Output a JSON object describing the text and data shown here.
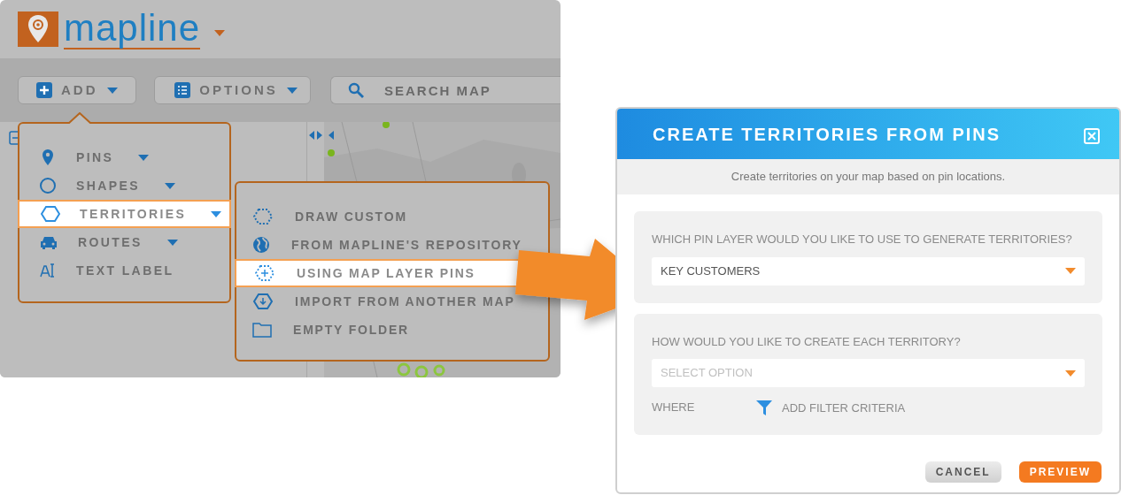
{
  "app": {
    "logo_text": "mapline",
    "toolbar": [
      {
        "kind": "add",
        "label": "ADD"
      },
      {
        "kind": "options",
        "label": "OPTIONS"
      }
    ],
    "search": {
      "placeholder": "SEARCH MAP"
    }
  },
  "add_menu": {
    "items": [
      {
        "kind": "pin",
        "label": "PINS",
        "expandable": true,
        "selected": false
      },
      {
        "kind": "circle",
        "label": "SHAPES",
        "expandable": true,
        "selected": false
      },
      {
        "kind": "hexagon",
        "label": "TERRITORIES",
        "expandable": true,
        "selected": true
      },
      {
        "kind": "car",
        "label": "ROUTES",
        "expandable": true,
        "selected": false
      },
      {
        "kind": "text",
        "label": "TEXT LABEL",
        "expandable": false,
        "selected": false
      }
    ]
  },
  "territories_menu": {
    "items": [
      {
        "kind": "dotted-hexagon",
        "label": "DRAW CUSTOM",
        "selected": false
      },
      {
        "kind": "globe",
        "label": "FROM MAPLINE'S REPOSITORY",
        "selected": false
      },
      {
        "kind": "plus-hexagon",
        "label": "USING MAP LAYER PINS",
        "selected": true
      },
      {
        "kind": "download-hexagon",
        "label": "IMPORT FROM ANOTHER MAP",
        "selected": false
      },
      {
        "kind": "folder",
        "label": "EMPTY FOLDER",
        "selected": false
      }
    ]
  },
  "dialog": {
    "title": "CREATE TERRITORIES FROM PINS",
    "subtitle": "Create territories on your map based on pin locations.",
    "sections": [
      {
        "question": "WHICH PIN LAYER WOULD YOU LIKE TO USE TO GENERATE TERRITORIES?",
        "select": {
          "value": "KEY CUSTOMERS"
        }
      },
      {
        "question": "HOW WOULD YOU LIKE TO CREATE EACH TERRITORY?",
        "select": {
          "placeholder": "SELECT OPTION"
        },
        "where_label": "WHERE",
        "filter_link": "ADD FILTER CRITERIA"
      }
    ],
    "buttons": [
      {
        "kind": "secondary",
        "label": "CANCEL"
      },
      {
        "kind": "primary",
        "label": "PREVIEW"
      }
    ]
  }
}
